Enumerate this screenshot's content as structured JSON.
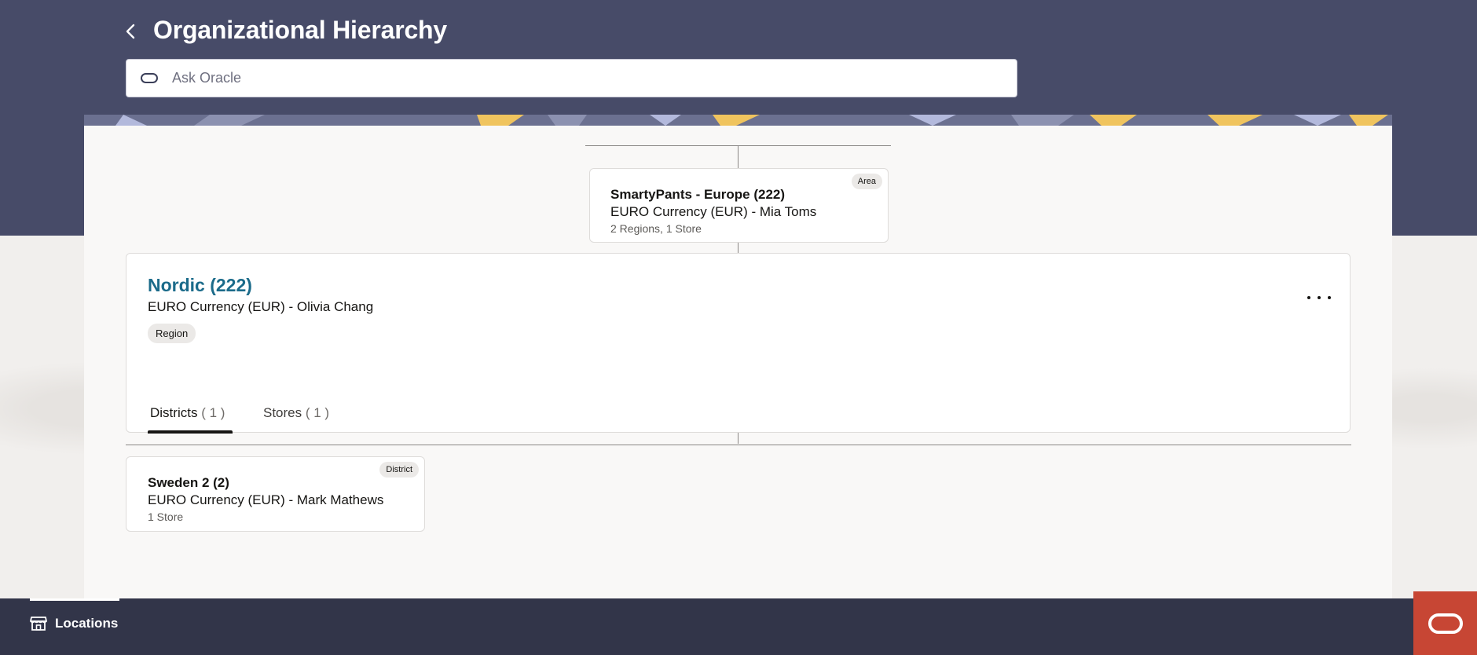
{
  "header": {
    "title": "Organizational Hierarchy",
    "ask_placeholder": "Ask Oracle"
  },
  "parent_node": {
    "title": "SmartyPants - Europe (222)",
    "currency_owner": "EURO Currency (EUR) - Mia Toms",
    "summary": "2 Regions, 1 Store",
    "badge": "Area"
  },
  "selected_node": {
    "title": "Nordic (222)",
    "currency_owner": "EURO Currency (EUR) - Olivia Chang",
    "badge": "Region",
    "tabs": [
      {
        "label": "Districts",
        "count": "( 1 )",
        "selected": true
      },
      {
        "label": "Stores",
        "count": "( 1 )",
        "selected": false
      }
    ]
  },
  "child_nodes": [
    {
      "title": "Sweden 2 (2)",
      "currency_owner": "EURO Currency (EUR) - Mark Mathews",
      "summary": "1 Store",
      "badge": "District"
    }
  ],
  "footer": {
    "locations_label": "Locations"
  },
  "colors": {
    "hero": "#474b68",
    "footer": "#323549",
    "link": "#1b6b8a",
    "oracle_red": "#c74634"
  }
}
